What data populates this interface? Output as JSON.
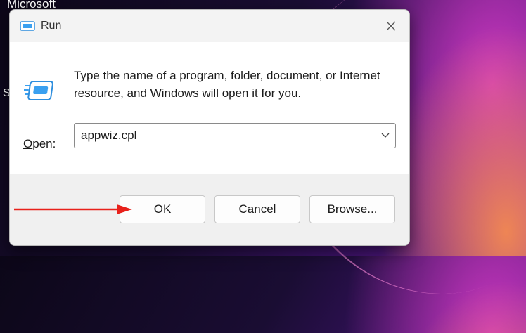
{
  "desktop": {
    "top_left_text": "Microsoft",
    "side_text": "S"
  },
  "dialog": {
    "title": "Run",
    "icons": {
      "title": "run-icon",
      "close": "close-icon",
      "main": "run-icon",
      "dropdown": "chevron-down-icon"
    },
    "description": "Type the name of a program, folder, document, or Internet resource, and Windows will open it for you.",
    "open_label_accel": "O",
    "open_label_rest": "pen:",
    "open_value": "appwiz.cpl",
    "buttons": {
      "ok": "OK",
      "cancel": "Cancel",
      "browse_accel": "B",
      "browse_rest": "rowse..."
    }
  },
  "annotation": {
    "arrow_color": "#e8211b"
  },
  "colors": {
    "accent": "#0078d4"
  }
}
